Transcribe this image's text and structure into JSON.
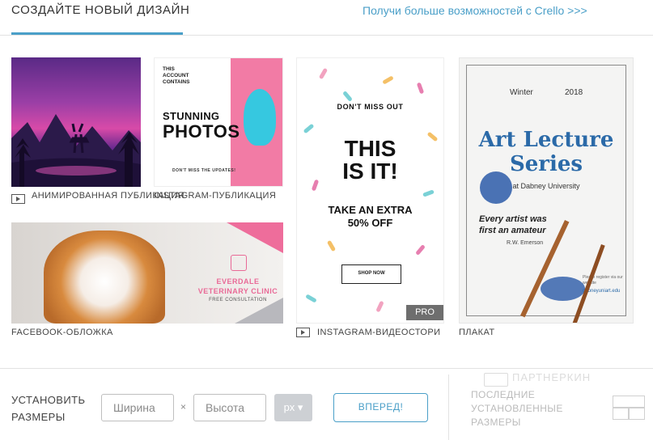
{
  "header": {
    "title": "СОЗДАЙТЕ НОВЫЙ ДИЗАЙН",
    "upgrade_link": "Получи больше возможностей с Crello >>>"
  },
  "templates": {
    "animated": {
      "label": "АНИМИРОВАННАЯ ПУБЛИКАЦИЯ",
      "icon": "video-icon"
    },
    "instagram_post": {
      "label": "INSTAGRAM-ПУБЛИКАЦИЯ",
      "preview": {
        "small_text_1": "THIS",
        "small_text_2": "ACCOUNT",
        "small_text_3": "CONTAINS",
        "line1": "STUNNING",
        "line2": "PHOTOS",
        "footer": "DON'T MISS THE UPDATES!"
      }
    },
    "facebook_cover": {
      "label": "FACEBOOK-ОБЛОЖКА",
      "preview": {
        "line1": "EVERDALE",
        "line2": "VETERINARY CLINIC",
        "line3": "FREE CONSULTATION"
      }
    },
    "instagram_story": {
      "label": "INSTAGRAM-ВИДЕОСТОРИ",
      "icon": "video-icon",
      "badge": "PRO",
      "preview": {
        "top": "DON'T MISS OUT",
        "headline1": "THIS",
        "headline2": "IS IT!",
        "offer1": "TAKE AN EXTRA",
        "offer2": "50% OFF",
        "button": "SHOP NOW"
      }
    },
    "poster": {
      "label": "ПЛАКАТ",
      "preview": {
        "season": "Winter",
        "year": "2018",
        "title1": "Art Lecture",
        "title2": "Series",
        "venue": "at Dabney University",
        "quote1": "Every artist was",
        "quote2": "first an amateur",
        "author": "R.W. Emerson",
        "register": "Please register via our website",
        "url": "dabneyuniart.edu"
      }
    }
  },
  "footer": {
    "set_size_line1": "УСТАНОВИТЬ",
    "set_size_line2": "РАЗМЕРЫ",
    "width_placeholder": "Ширина",
    "height_placeholder": "Высота",
    "times": "×",
    "unit": "px ▾",
    "go_button": "ВПЕРЕД!",
    "recent_line1": "ПОСЛЕДНИЕ",
    "recent_line2": "УСТАНОВЛЕННЫЕ",
    "recent_line3": "РАЗМЕРЫ",
    "watermark": "ПАРТНЕРКИН"
  },
  "colors": {
    "accent": "#4a9fc8",
    "divider": "#e2e2e2",
    "unit_bg": "#cdd0d4",
    "pro_badge": "#6e6e6e"
  }
}
